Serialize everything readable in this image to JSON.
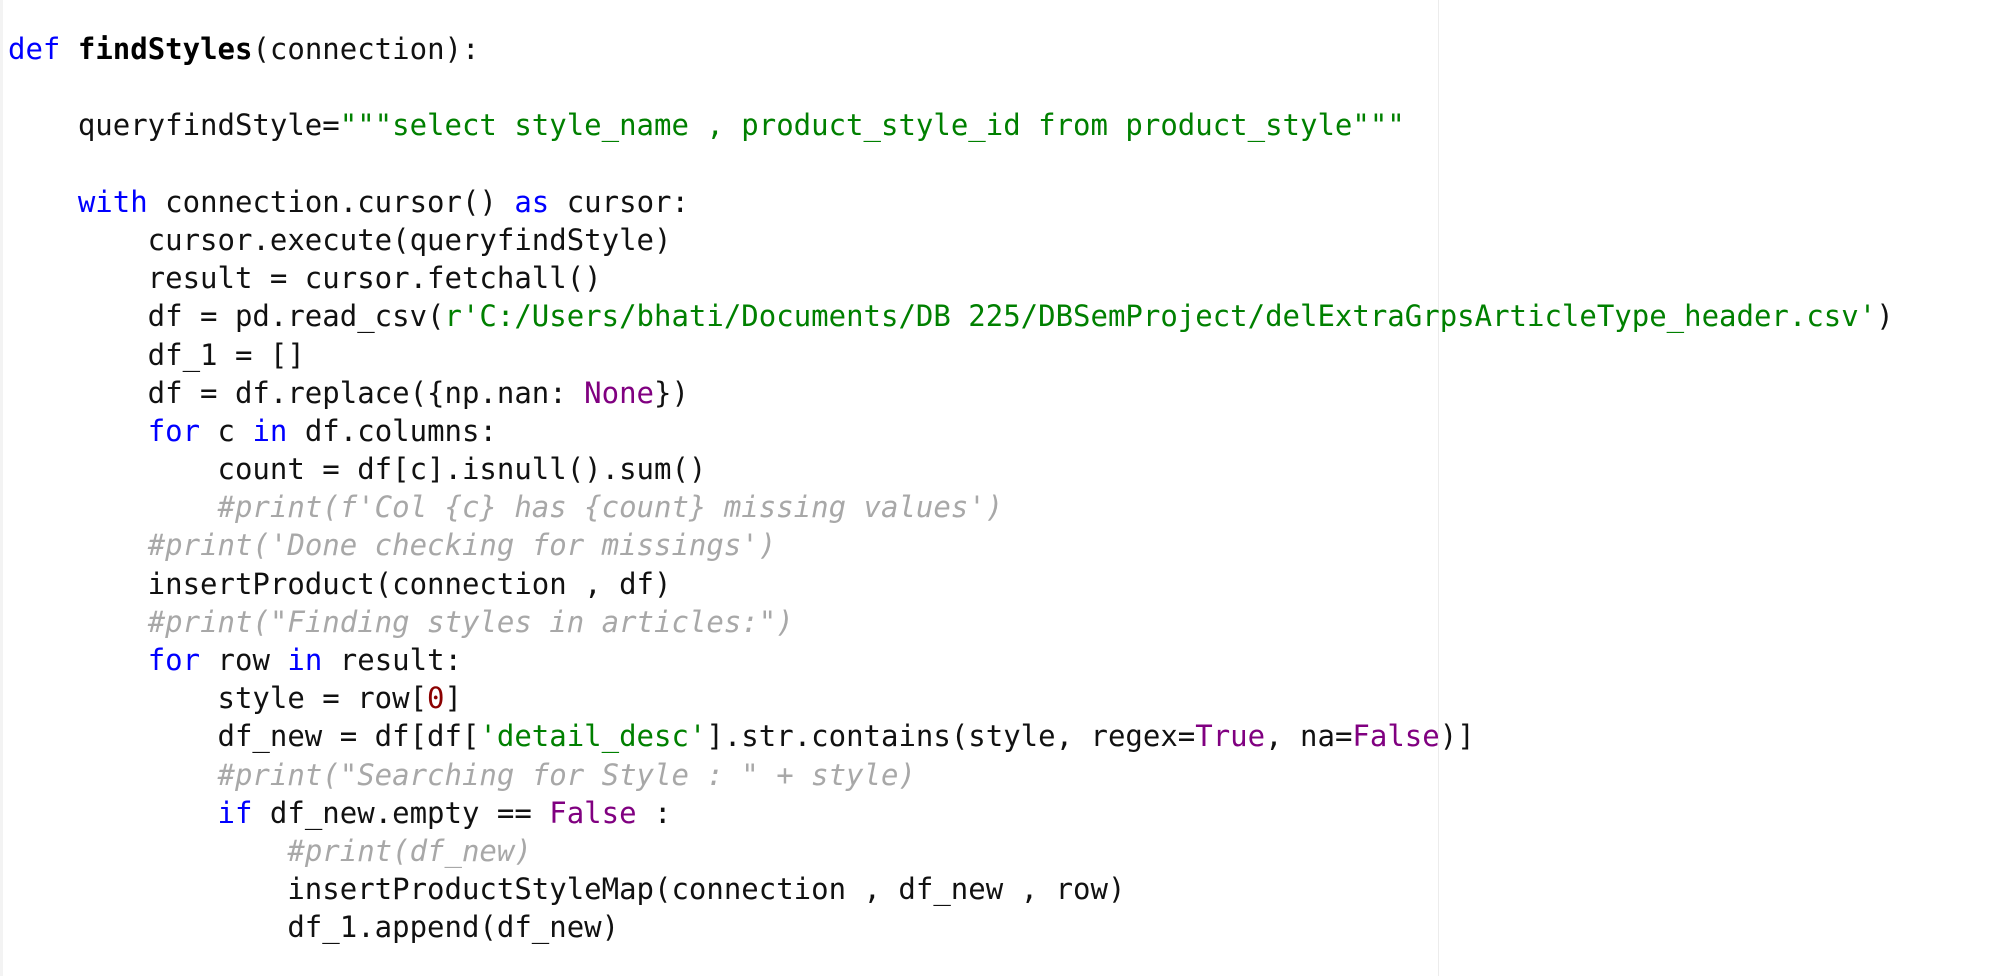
{
  "editor": {
    "lines": [
      [
        {
          "t": "def",
          "c": "kw"
        },
        {
          "t": " ",
          "c": "pl"
        },
        {
          "t": "findStyles",
          "c": "fn"
        },
        {
          "t": "(connection):",
          "c": "pl"
        }
      ],
      [],
      [
        {
          "t": "    queryfindStyle=",
          "c": "pl"
        },
        {
          "t": "\"\"\"select style_name , product_style_id from product_style\"\"\"",
          "c": "str"
        }
      ],
      [],
      [
        {
          "t": "    ",
          "c": "pl"
        },
        {
          "t": "with",
          "c": "kw"
        },
        {
          "t": " connection.cursor() ",
          "c": "pl"
        },
        {
          "t": "as",
          "c": "kw"
        },
        {
          "t": " cursor:",
          "c": "pl"
        }
      ],
      [
        {
          "t": "        cursor.execute(queryfindStyle)",
          "c": "pl"
        }
      ],
      [
        {
          "t": "        result = cursor.fetchall()",
          "c": "pl"
        }
      ],
      [
        {
          "t": "        df = pd.read_csv(",
          "c": "pl"
        },
        {
          "t": "r'C:/Users/bhati/Documents/DB 225/DBSemProject/delExtraGrpsArticleType_header.csv'",
          "c": "str"
        },
        {
          "t": ")",
          "c": "pl"
        }
      ],
      [
        {
          "t": "        df_1 = []",
          "c": "pl"
        }
      ],
      [
        {
          "t": "        df = df.replace({np.nan: ",
          "c": "pl"
        },
        {
          "t": "None",
          "c": "bi"
        },
        {
          "t": "})",
          "c": "pl"
        }
      ],
      [
        {
          "t": "        ",
          "c": "pl"
        },
        {
          "t": "for",
          "c": "kw"
        },
        {
          "t": " c ",
          "c": "pl"
        },
        {
          "t": "in",
          "c": "kw"
        },
        {
          "t": " df.columns:",
          "c": "pl"
        }
      ],
      [
        {
          "t": "            count = df[c].isnull().sum()",
          "c": "pl"
        }
      ],
      [
        {
          "t": "            ",
          "c": "pl"
        },
        {
          "t": "#print(f'Col {c} has {count} missing values')",
          "c": "cm"
        }
      ],
      [
        {
          "t": "        ",
          "c": "pl"
        },
        {
          "t": "#print('Done checking for missings')",
          "c": "cm"
        }
      ],
      [
        {
          "t": "        insertProduct(connection , df)",
          "c": "pl"
        }
      ],
      [
        {
          "t": "        ",
          "c": "pl"
        },
        {
          "t": "#print(\"Finding styles in articles:\")",
          "c": "cm"
        }
      ],
      [
        {
          "t": "        ",
          "c": "pl"
        },
        {
          "t": "for",
          "c": "kw"
        },
        {
          "t": " row ",
          "c": "pl"
        },
        {
          "t": "in",
          "c": "kw"
        },
        {
          "t": " result:",
          "c": "pl"
        }
      ],
      [
        {
          "t": "            style = row[",
          "c": "pl"
        },
        {
          "t": "0",
          "c": "num"
        },
        {
          "t": "]",
          "c": "pl"
        }
      ],
      [
        {
          "t": "            df_new = df[df[",
          "c": "pl"
        },
        {
          "t": "'detail_desc'",
          "c": "str"
        },
        {
          "t": "].str.contains(style, regex=",
          "c": "pl"
        },
        {
          "t": "True",
          "c": "bi"
        },
        {
          "t": ", na=",
          "c": "pl"
        },
        {
          "t": "False",
          "c": "bi"
        },
        {
          "t": ")]",
          "c": "pl"
        }
      ],
      [
        {
          "t": "            ",
          "c": "pl"
        },
        {
          "t": "#print(\"Searching for Style : \" + style)",
          "c": "cm"
        }
      ],
      [
        {
          "t": "            ",
          "c": "pl"
        },
        {
          "t": "if",
          "c": "kw"
        },
        {
          "t": " df_new.empty == ",
          "c": "pl"
        },
        {
          "t": "False",
          "c": "bi"
        },
        {
          "t": " :",
          "c": "pl"
        }
      ],
      [
        {
          "t": "                ",
          "c": "pl"
        },
        {
          "t": "#print(df_new)",
          "c": "cm"
        }
      ],
      [
        {
          "t": "                insertProductStyleMap(connection , df_new , row)",
          "c": "pl"
        }
      ],
      [
        {
          "t": "                df_1.append(df_new)",
          "c": "pl"
        }
      ]
    ]
  }
}
